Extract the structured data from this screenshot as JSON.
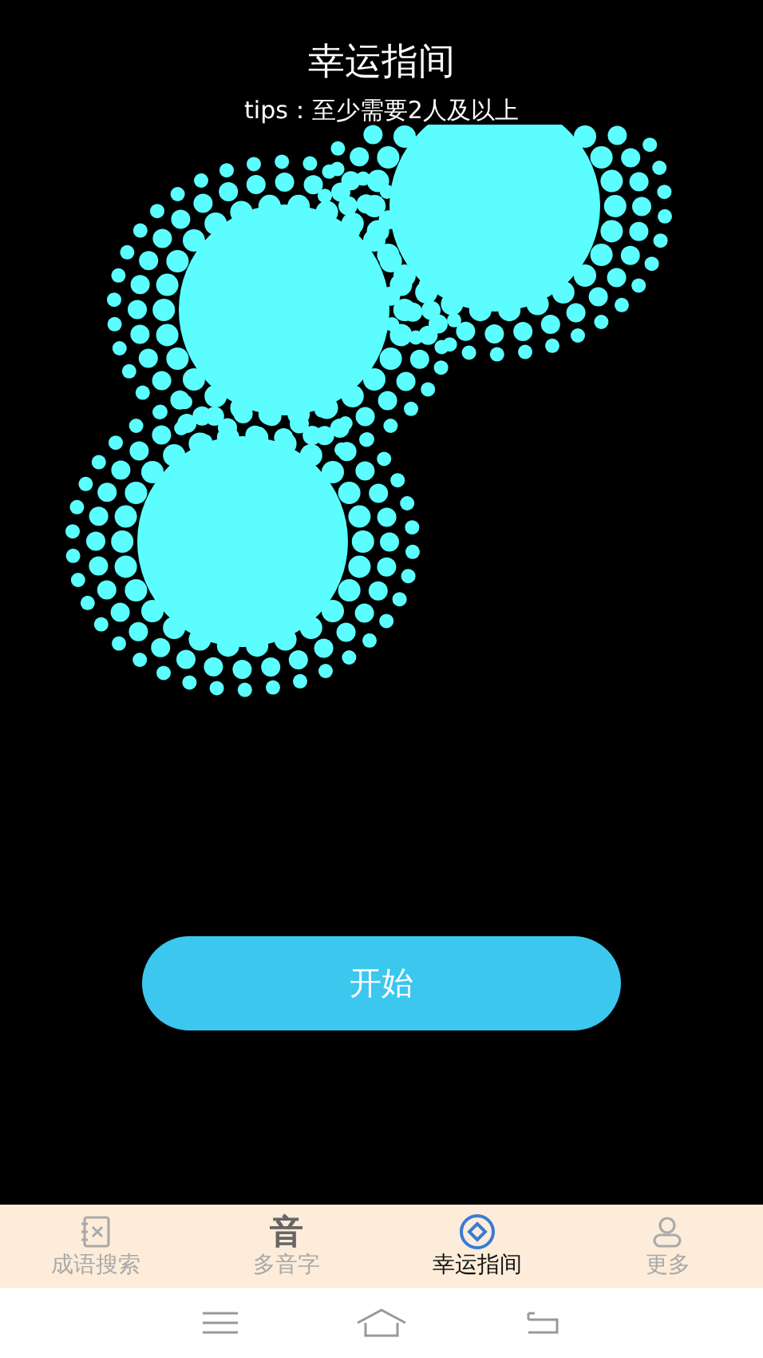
{
  "header": {
    "title": "幸运指间",
    "tip": "tips：至少需要2人及以上"
  },
  "start_button": "开始",
  "tab_bar": [
    {
      "kind": "icon",
      "label": "成语搜索",
      "selected": false
    },
    {
      "kind": "glyph",
      "glyph": "音",
      "label": "多音字",
      "selected": false
    },
    {
      "kind": "icon",
      "label": "幸运指间",
      "selected": true
    },
    {
      "kind": "icon",
      "label": "更多",
      "selected": false
    }
  ]
}
